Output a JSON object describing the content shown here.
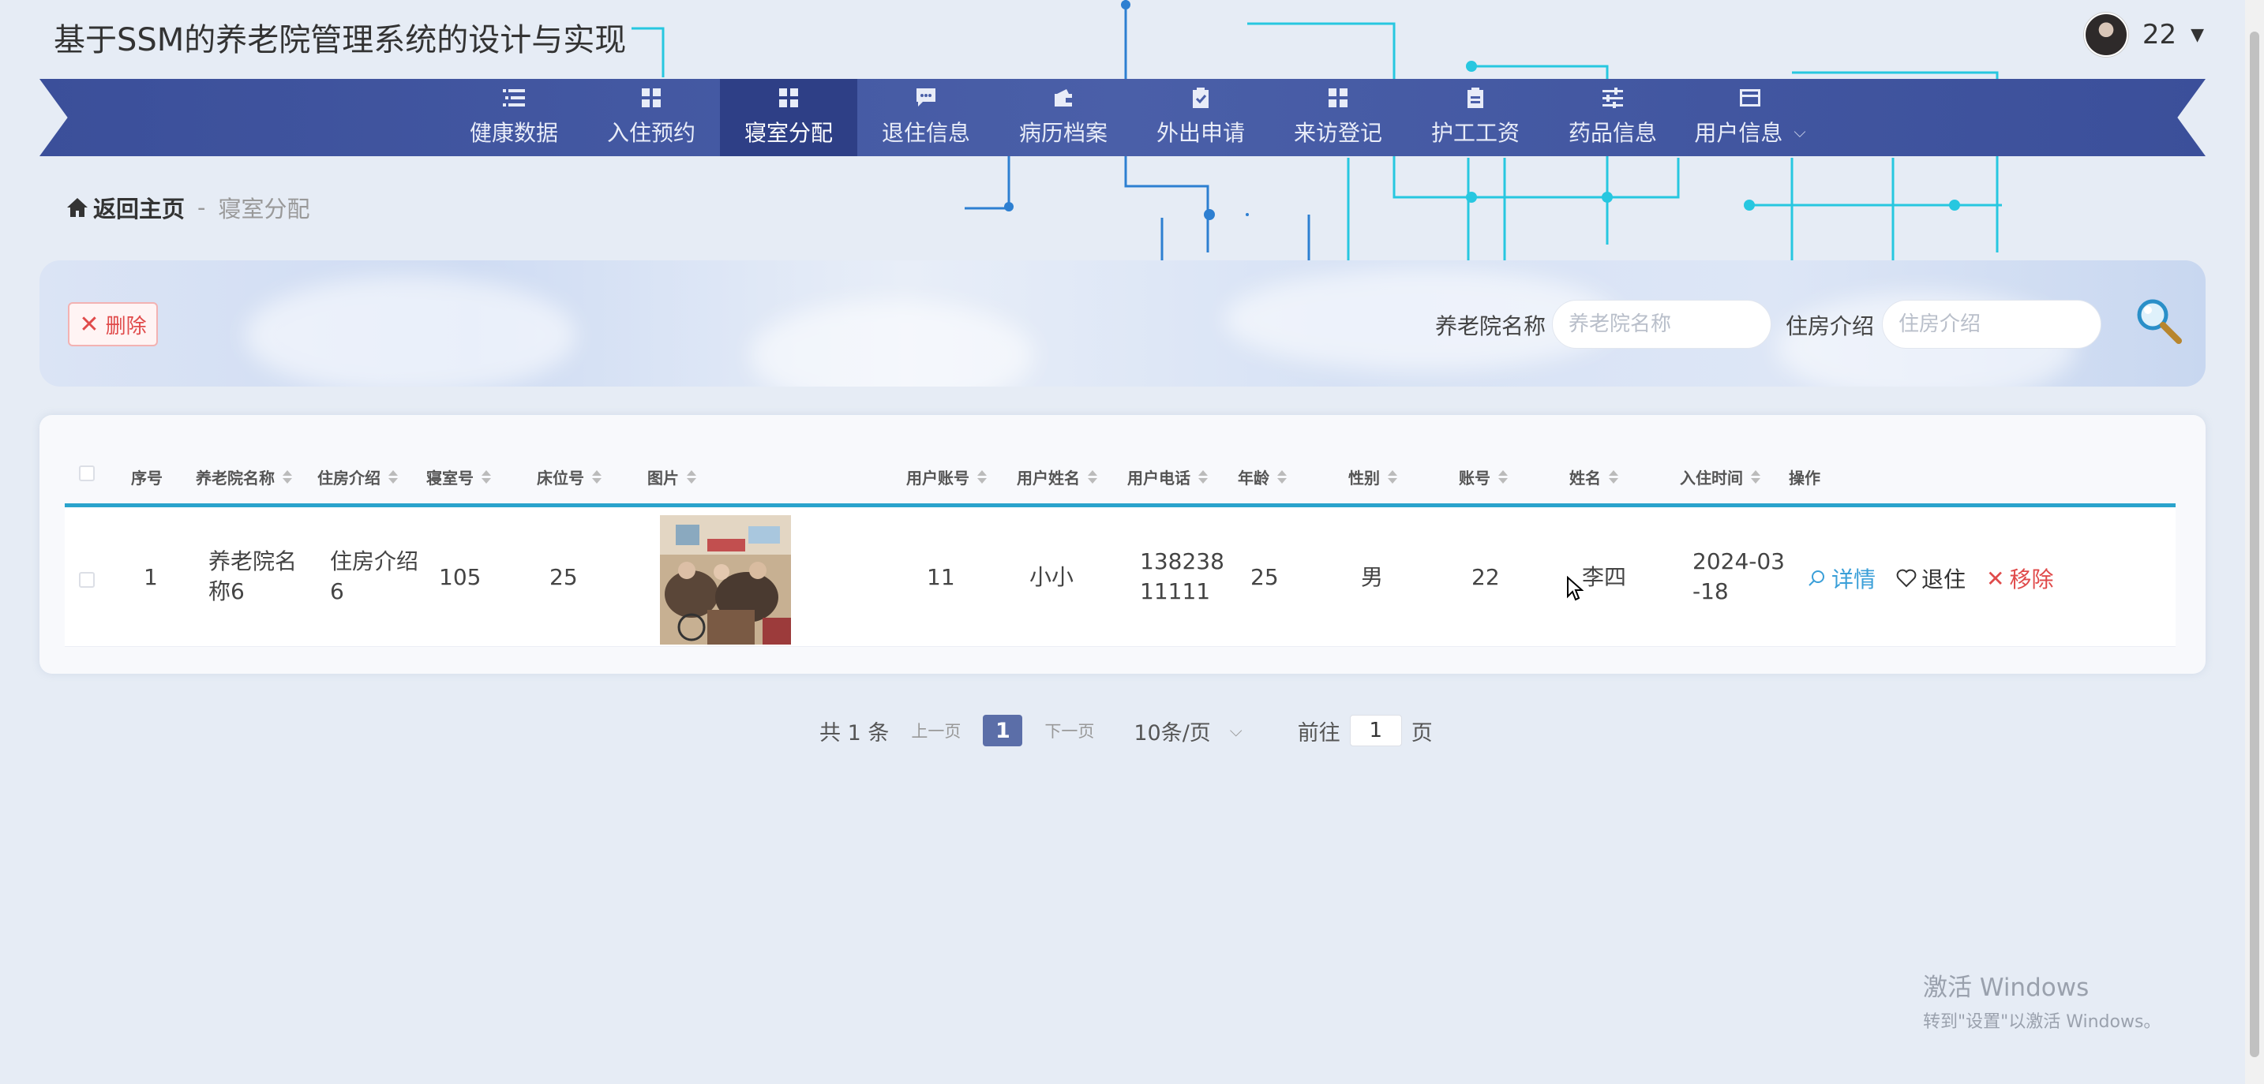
{
  "app_title": "基于SSM的养老院管理系统的设计与实现",
  "user": {
    "name": "22"
  },
  "nav": [
    {
      "label": "健康数据",
      "icon": "list-icon"
    },
    {
      "label": "入住预约",
      "icon": "grid-icon"
    },
    {
      "label": "寝室分配",
      "icon": "grid-icon",
      "active": true
    },
    {
      "label": "退住信息",
      "icon": "chat-icon"
    },
    {
      "label": "病历档案",
      "icon": "wallet-icon"
    },
    {
      "label": "外出申请",
      "icon": "clipboard-check-icon"
    },
    {
      "label": "来访登记",
      "icon": "grid-icon"
    },
    {
      "label": "护工工资",
      "icon": "clipboard-icon"
    },
    {
      "label": "药品信息",
      "icon": "sliders-icon"
    },
    {
      "label": "用户信息",
      "icon": "card-icon",
      "dropdown": true
    }
  ],
  "breadcrumb": {
    "home": "返回主页",
    "separator": "-",
    "current": "寝室分配"
  },
  "toolbar": {
    "delete_label": "删除",
    "field1_label": "养老院名称",
    "field1_placeholder": "养老院名称",
    "field2_label": "住房介绍",
    "field2_placeholder": "住房介绍"
  },
  "table": {
    "headers": {
      "index": "序号",
      "nursing_home": "养老院名称",
      "housing": "住房介绍",
      "room": "寝室号",
      "bed": "床位号",
      "image": "图片",
      "user_account": "用户账号",
      "user_name": "用户姓名",
      "user_phone": "用户电话",
      "age": "年龄",
      "gender": "性别",
      "account": "账号",
      "name": "姓名",
      "checkin": "入住时间",
      "actions": "操作"
    },
    "rows": [
      {
        "index": "1",
        "nursing_home_1": "养老院名",
        "nursing_home_2": "称6",
        "housing_1": "住房介绍",
        "housing_2": "6",
        "room": "105",
        "bed": "25",
        "user_account": "11",
        "user_name": "小小",
        "user_phone_1": "138238",
        "user_phone_2": "11111",
        "age": "25",
        "gender": "男",
        "account": "22",
        "name": "李四",
        "checkin_1": "2024-03",
        "checkin_2": "-18",
        "action_detail": "详情",
        "action_checkout": "退住",
        "action_remove": "移除"
      }
    ]
  },
  "pagination": {
    "total": "共 1 条",
    "prev": "上一页",
    "current": "1",
    "next": "下一页",
    "page_size": "10条/页",
    "goto_prefix": "前往",
    "goto_value": "1",
    "goto_suffix": "页"
  },
  "watermark": {
    "line1": "激活 Windows",
    "line2": "转到\"设置\"以激活 Windows。"
  },
  "colors": {
    "nav_bg": "#4a5fa8",
    "nav_active": "#2e3f86",
    "accent_line": "#2aa3cc",
    "danger": "#e04b4b",
    "detail": "#3a9fd8"
  }
}
